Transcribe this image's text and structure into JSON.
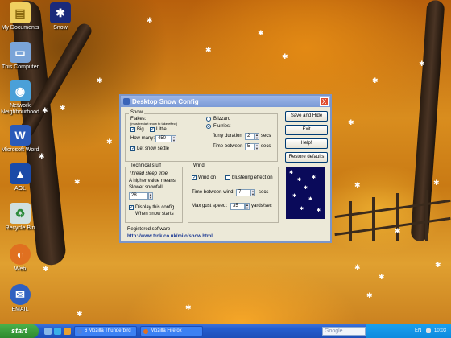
{
  "desktop": {
    "icons": [
      {
        "label": "My Documents"
      },
      {
        "label": "Snow"
      },
      {
        "label": "This Computer"
      },
      {
        "label": "Network Neighbourhood"
      },
      {
        "label": "Microsoft Word"
      },
      {
        "label": "AOL"
      },
      {
        "label": "Recycle Bin"
      },
      {
        "label": "Web"
      },
      {
        "label": "EMAIL"
      }
    ]
  },
  "dialog": {
    "title": "Desktop Snow Config",
    "close_glyph": "X",
    "snow": {
      "group_label": "Snow",
      "flakes_label": "Flakes:",
      "flakes_note": "(must restart snow to take effect)",
      "big_label": "Big",
      "big_checked": true,
      "little_label": "Little",
      "little_checked": true,
      "how_many_label": "How many:",
      "how_many_value": "450",
      "let_snow_settle_label": "Let snow settle",
      "let_snow_settle_checked": true,
      "blizzard_label": "Blizzard",
      "flurries_label": "Flurries:",
      "selected_mode": "Flurries",
      "flurry_duration_label": "flurry duration",
      "flurry_duration_value": "2",
      "secs_label": "secs",
      "time_between_label": "Time between",
      "time_between_value": "5"
    },
    "technical": {
      "group_label": "Technical stuff",
      "sleep_time_label": "Thread sleep time",
      "higher_value_label": "A higher value means",
      "slower_snowfall_label": "Slower snowfall",
      "sleep_value": "28",
      "display_config_label": "Display this config",
      "when_snow_starts_label": "When snow starts",
      "display_config_checked": true
    },
    "wind": {
      "group_label": "Wind",
      "wind_on_label": "Wind on",
      "wind_on_checked": true,
      "blustering_label": "blustering effect on",
      "blustering_checked": false,
      "time_between_label": "Time between wind:",
      "time_between_value": "7",
      "secs_label": "secs",
      "max_gust_label": "Max gust speed:",
      "max_gust_value": "35",
      "yards_label": "yards/sec"
    },
    "buttons": {
      "save_hide": "Save and Hide",
      "exit": "Exit",
      "help": "Help!",
      "restore": "Restore defaults"
    },
    "registration": {
      "label": "Registered software",
      "url": "http://www.trok.co.uk/milo/snow.html"
    }
  },
  "taskbar": {
    "start_label": "start",
    "tasks": [
      {
        "label": "6 Mozilla Thunderbird"
      },
      {
        "label": "Mozilla Firefox"
      }
    ],
    "search_placeholder": "Google",
    "language": "EN",
    "clock": "10:03"
  }
}
